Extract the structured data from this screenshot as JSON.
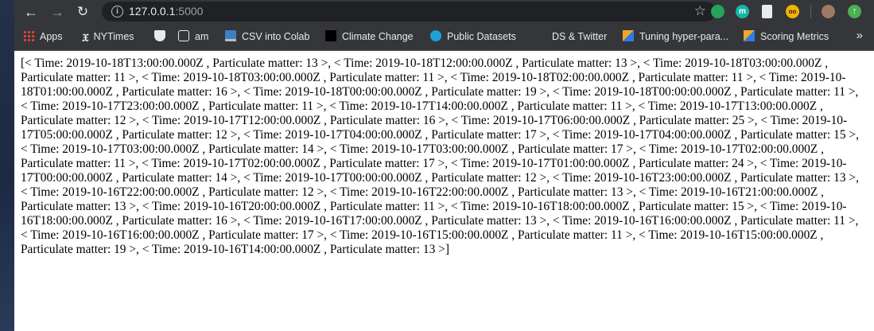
{
  "browser": {
    "url_host": "127.0.0.1",
    "url_port": ":5000",
    "extensions": {
      "ext1": {
        "label": ""
      },
      "ext2": {
        "label": "m"
      },
      "ext4": {
        "label": "oo"
      }
    }
  },
  "bookmarks": {
    "apps": "Apps",
    "nytimes": "NYTimes",
    "am": "am",
    "csv_colab": "CSV into Colab",
    "climate": "Climate Change",
    "datasets": "Public Datasets",
    "ds_twitter": "DS & Twitter",
    "tuning": "Tuning hyper-para...",
    "scoring": "Scoring Metrics",
    "more": "»"
  },
  "page": {
    "body_text": "[< Time: 2019-10-18T13:00:00.000Z , Particulate matter: 13 >, < Time: 2019-10-18T12:00:00.000Z , Particulate matter: 13 >, < Time: 2019-10-18T03:00:00.000Z , Particulate matter: 11 >, < Time: 2019-10-18T03:00:00.000Z , Particulate matter: 11 >, < Time: 2019-10-18T02:00:00.000Z , Particulate matter: 11 >, < Time: 2019-10-18T01:00:00.000Z , Particulate matter: 16 >, < Time: 2019-10-18T00:00:00.000Z , Particulate matter: 19 >, < Time: 2019-10-18T00:00:00.000Z , Particulate matter: 11 >, < Time: 2019-10-17T23:00:00.000Z , Particulate matter: 11 >, < Time: 2019-10-17T14:00:00.000Z , Particulate matter: 11 >, < Time: 2019-10-17T13:00:00.000Z , Particulate matter: 12 >, < Time: 2019-10-17T12:00:00.000Z , Particulate matter: 16 >, < Time: 2019-10-17T06:00:00.000Z , Particulate matter: 25 >, < Time: 2019-10-17T05:00:00.000Z , Particulate matter: 12 >, < Time: 2019-10-17T04:00:00.000Z , Particulate matter: 17 >, < Time: 2019-10-17T04:00:00.000Z , Particulate matter: 15 >, < Time: 2019-10-17T03:00:00.000Z , Particulate matter: 14 >, < Time: 2019-10-17T03:00:00.000Z , Particulate matter: 17 >, < Time: 2019-10-17T02:00:00.000Z , Particulate matter: 11 >, < Time: 2019-10-17T02:00:00.000Z , Particulate matter: 17 >, < Time: 2019-10-17T01:00:00.000Z , Particulate matter: 24 >, < Time: 2019-10-17T00:00:00.000Z , Particulate matter: 14 >, < Time: 2019-10-17T00:00:00.000Z , Particulate matter: 12 >, < Time: 2019-10-16T23:00:00.000Z , Particulate matter: 13 >, < Time: 2019-10-16T22:00:00.000Z , Particulate matter: 12 >, < Time: 2019-10-16T22:00:00.000Z , Particulate matter: 13 >, < Time: 2019-10-16T21:00:00.000Z , Particulate matter: 13 >, < Time: 2019-10-16T20:00:00.000Z , Particulate matter: 11 >, < Time: 2019-10-16T18:00:00.000Z , Particulate matter: 15 >, < Time: 2019-10-16T18:00:00.000Z , Particulate matter: 16 >, < Time: 2019-10-16T17:00:00.000Z , Particulate matter: 13 >, < Time: 2019-10-16T16:00:00.000Z , Particulate matter: 11 >, < Time: 2019-10-16T16:00:00.000Z , Particulate matter: 17 >, < Time: 2019-10-16T15:00:00.000Z , Particulate matter: 11 >, < Time: 2019-10-16T15:00:00.000Z , Particulate matter: 19 >, < Time: 2019-10-16T14:00:00.000Z , Particulate matter: 13 >]"
  },
  "icons": {
    "back": "back-arrow-icon",
    "forward": "forward-arrow-icon",
    "reload": "reload-icon",
    "info": "site-info-icon",
    "bookmark_star": "bookmark-star-icon"
  },
  "colors": {
    "toolbar": "#35363a",
    "omnibox": "#202124",
    "page_bg": "#ffffff"
  }
}
